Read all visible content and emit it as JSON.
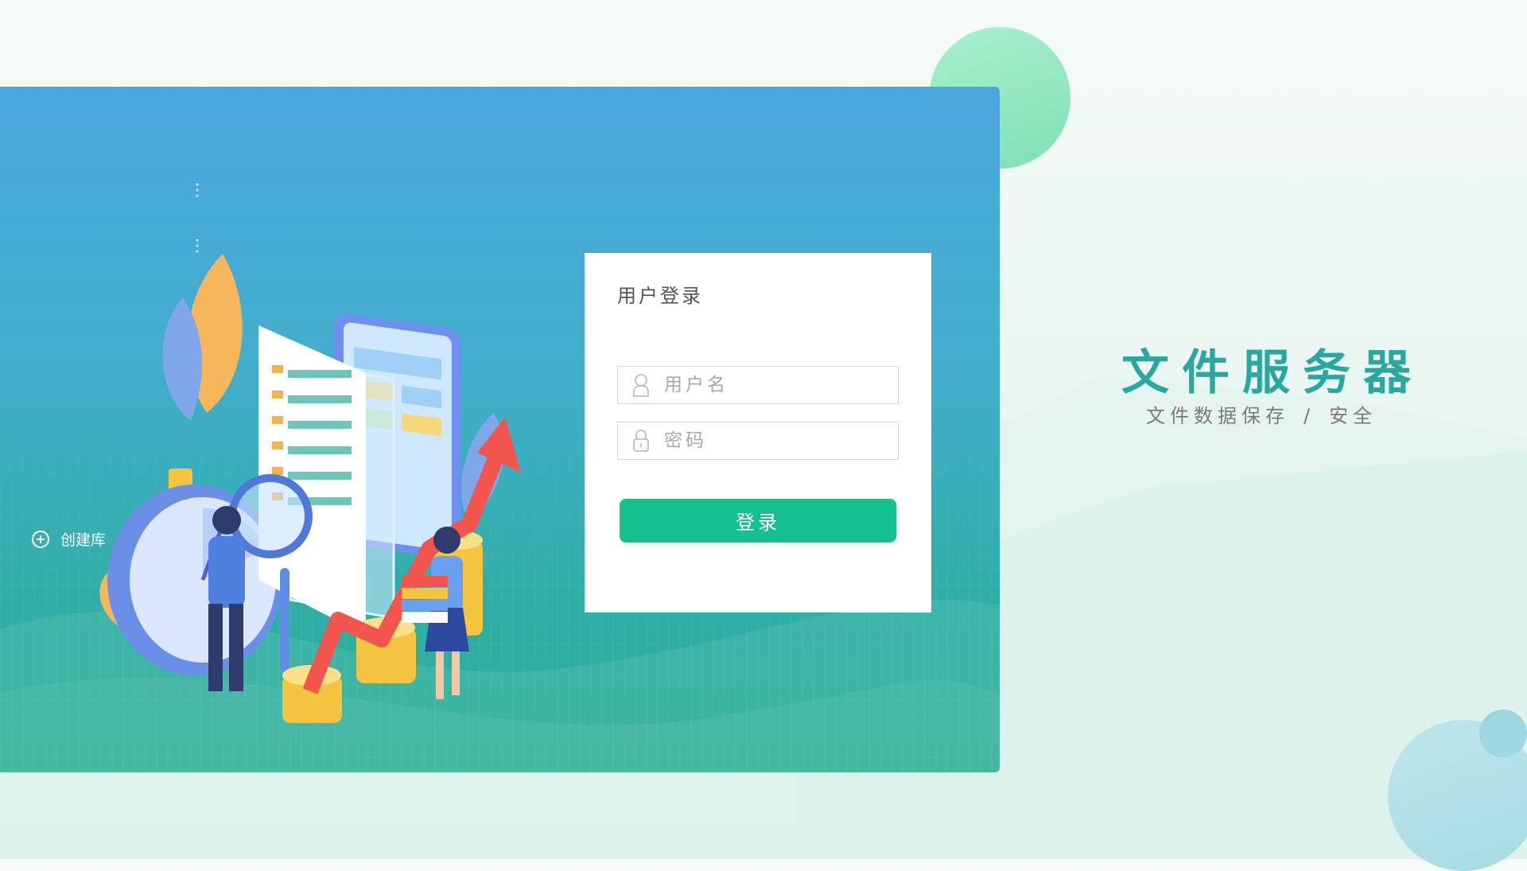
{
  "sidebar": {
    "create_repo_label": "创建库"
  },
  "login": {
    "title": "用户登录",
    "username_placeholder": "用户名",
    "username_value": "",
    "password_placeholder": "密码",
    "password_value": "",
    "submit_label": "登录"
  },
  "brand": {
    "title": "文件服务器",
    "subtitle_left": "文件数据保存",
    "subtitle_sep": "/",
    "subtitle_right": "安全"
  },
  "icons": {
    "create": "plus-circle-icon",
    "username": "user-icon",
    "password": "lock-icon"
  },
  "colors": {
    "accent": "#15c08f",
    "brand_title": "#2aa8a0",
    "hero_top": "#4ba7dd",
    "hero_bottom": "#2aae93"
  }
}
